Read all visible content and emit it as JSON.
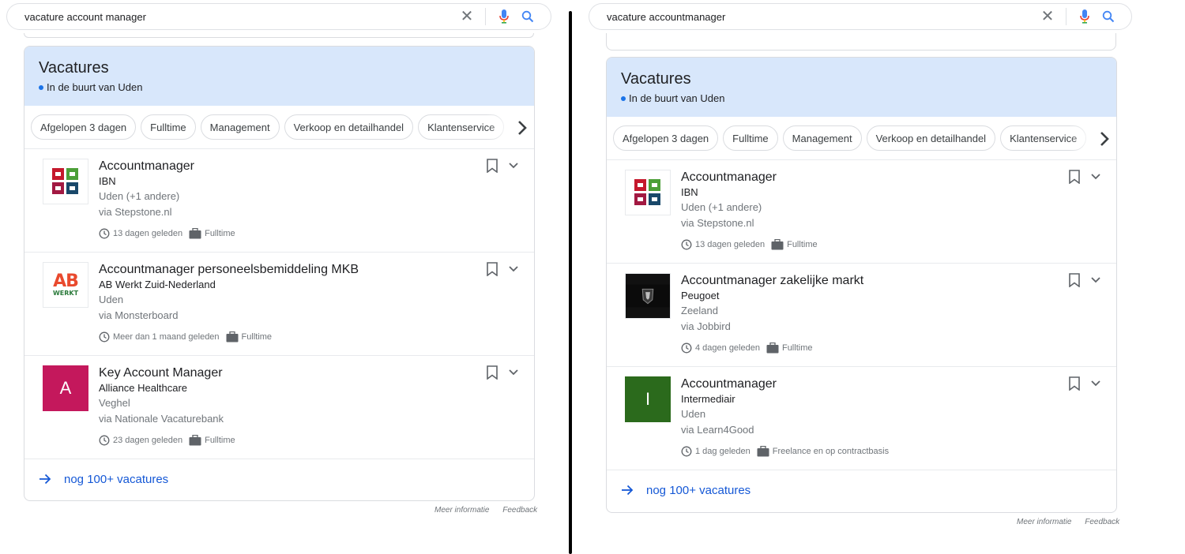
{
  "left": {
    "query": "vacature account manager",
    "card_title": "Vacatures",
    "location": "In de buurt van Uden",
    "chips": [
      "Afgelopen 3 dagen",
      "Fulltime",
      "Management",
      "Verkoop en detailhandel",
      "Klantenservice"
    ],
    "jobs": [
      {
        "title": "Accountmanager",
        "company": "IBN",
        "location": "Uden (+1 andere)",
        "via": "via Stepstone.nl",
        "posted": "13 dagen geleden",
        "type": "Fulltime",
        "logo": "ibn-logo"
      },
      {
        "title": "Accountmanager personeelsbemiddeling MKB",
        "company": "AB Werkt Zuid-Nederland",
        "location": "Uden",
        "via": "via Monsterboard",
        "posted": "Meer dan 1 maand geleden",
        "type": "Fulltime",
        "logo": "ab-werkt-logo",
        "logo_text": "AB",
        "logo_subtext": "WERKT"
      },
      {
        "title": "Key Account Manager",
        "company": "Alliance Healthcare",
        "location": "Veghel",
        "via": "via Nationale Vacaturebank",
        "posted": "23 dagen geleden",
        "type": "Fulltime",
        "logo": "letter-logo",
        "logo_text": "A"
      }
    ],
    "more_link": "nog 100+ vacatures",
    "footer": [
      "Meer informatie",
      "Feedback"
    ]
  },
  "right": {
    "query": "vacature accountmanager",
    "card_title": "Vacatures",
    "location": "In de buurt van Uden",
    "chips": [
      "Afgelopen 3 dagen",
      "Fulltime",
      "Management",
      "Verkoop en detailhandel",
      "Klantenservice"
    ],
    "jobs": [
      {
        "title": "Accountmanager",
        "company": "IBN",
        "location": "Uden (+1 andere)",
        "via": "via Stepstone.nl",
        "posted": "13 dagen geleden",
        "type": "Fulltime",
        "logo": "ibn-logo"
      },
      {
        "title": "Accountmanager zakelijke markt",
        "company": "Peugoet",
        "location": "Zeeland",
        "via": "via Jobbird",
        "posted": "4 dagen geleden",
        "type": "Fulltime",
        "logo": "peugeot-logo"
      },
      {
        "title": "Accountmanager",
        "company": "Intermediair",
        "location": "Uden",
        "via": "via Learn4Good",
        "posted": "1 dag geleden",
        "type": "Freelance en op contractbasis",
        "logo": "letter-logo",
        "logo_text": "I"
      }
    ],
    "more_link": "nog 100+ vacatures",
    "footer": [
      "Meer informatie",
      "Feedback"
    ]
  },
  "colors": {
    "header_bg": "#d8e7fb",
    "link": "#1558d6",
    "logo_a": "#c4185c",
    "logo_i": "#2b6a1c"
  }
}
